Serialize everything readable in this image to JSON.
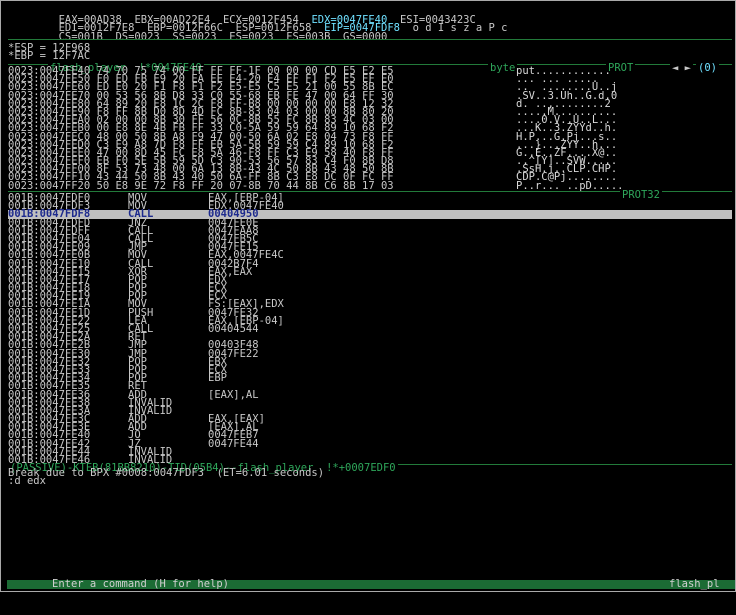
{
  "regs": [
    "EAX=00AD38  EBX=00AD22E4  ECX=0012F454  EDX=0047FE40  ESI=0043423C",
    "EDI=0012F7E8  EBP=0012F66C  ESP=0012F658  EIP=0047FDF8  o d I s z a P c",
    "CS=001B  DS=0023  SS=0023  ES=0023  FS=003B  GS=0000"
  ],
  "stack": [
    "*ESP = 12F968",
    "*EBP = 12F7AC"
  ],
  "data_label": "flash_player  !*0047FE40",
  "data_byte_label": "byte",
  "data_prot_label": "PROT",
  "data_index": "(0)",
  "data_rows": [
    {
      "addr": "0023:0047FE40",
      "bytes": "74 70 75 74 00 FF FF FF-1F 00 00 00 CD E5 E2 E5",
      "ascii": "put............"
    },
    {
      "addr": "0023:0047FE50",
      "bytes": "F0 ED FB E9 20 EA EE E4-20 E4 EF F1 F2 E5 EF E0",
      "ascii": "... ... ....."
    },
    {
      "addr": "0023:0047FE60",
      "bytes": "ED E0 20 F1 F8 F1 F2 E5-E5 C5 E5 21 00 55 8B EC",
      "ascii": "..  ........U..j"
    },
    {
      "addr": "0023:0047FE70",
      "bytes": "00 53 56 8B D8 33 C0 55-68 EB FE 47 00 64 FF 30",
      "ascii": ".SV..3.Uh..G.d.0"
    },
    {
      "addr": "0023:0047FE80",
      "bytes": "64 89 20 E8 1C 2C F8 FF-B8 00 00 00 00 E8 12 32",
      "ascii": "d. ..,........2"
    },
    {
      "addr": "0023:0047FE90",
      "bytes": "F8 FF 8B D0 8D 4D FC 8B-83 04 03 00 00 8B 80 20",
      "ascii": ".....M.........."
    },
    {
      "addr": "0023:0047FEA0",
      "bytes": "02 00 00 8B 30 FF 56 0C-8B 55 FC 8B 83 4C 03 00",
      "ascii": "....0.V..U..L..."
    },
    {
      "addr": "0023:0047FEB0",
      "bytes": "00 E8 8E 4B FB FF 33 C0-5A 59 59 64 89 10 68 F2",
      "ascii": "...K..3.ZYYd..h."
    },
    {
      "addr": "0023:0047FEC0",
      "bytes": "48 00 50 8B A8 F9 47 00-50 6A 02 E8 04 73 F8 FF",
      "ascii": "H.P...G.Pj...s.."
    },
    {
      "addr": "0023:0047FED0",
      "bytes": "C3 E9 A8 7D F8 FF EB 5A-5B 59 59 C4 89 10 68 F2",
      "ascii": "...}...ZYY..h..."
    },
    {
      "addr": "0023:0047FEE0",
      "bytes": "47 00 8D 45 FC E8 5A 46-F8 FF C3 E9 58 40 F8 FF",
      "ascii": "G..E..ZF....X@.."
    },
    {
      "addr": "0023:0047FEF0",
      "bytes": "EB F0 5E 5B 59 5D C3 90-53 56 57 83 C4 F0 8B D8",
      "ascii": "..^[Y]..SVW....."
    },
    {
      "addr": "0023:0047FF00",
      "bytes": "8F 53 73 48 00 6A 13 8B-43 4C 50 8B 43 48 50 8B",
      "ascii": ".SsH.j..CLP.CHP."
    },
    {
      "addr": "0023:0047FF10",
      "bytes": "43 44 50 8B 43 40 50 6A-FF 8B C3 E8 DC 0F FC FF",
      "ascii": "CDP.C@Pj........"
    },
    {
      "addr": "0023:0047FF20",
      "bytes": "50 E8 9E 72 F8 FF 20 07-8B 70 44 8B C6 8B 17 03",
      "ascii": "P..r... ..pD....."
    }
  ],
  "code_prot_label": "PROT32",
  "code_rows": [
    {
      "addr": "001B:0047FDF0",
      "mnem": "MOV",
      "ops": "EAX,[EBP-04]"
    },
    {
      "addr": "001B:0047FDF3",
      "mnem": "MOV",
      "ops": "EDX,0047FE40"
    },
    {
      "addr": "001B:0047FDF8",
      "mnem": "CALL",
      "ops": "00404950",
      "selected": true
    },
    {
      "addr": "001B:0047FDFD",
      "mnem": "JNZ",
      "ops": "0047FE0E"
    },
    {
      "addr": "001B:0047FDFF",
      "mnem": "CALL",
      "ops": "0047FAA8"
    },
    {
      "addr": "001B:0047FE04",
      "mnem": "CALL",
      "ops": "0047FB5C"
    },
    {
      "addr": "001B:0047FE09",
      "mnem": "JMP",
      "ops": "0047FE15"
    },
    {
      "addr": "001B:0047FE0B",
      "mnem": "MOV",
      "ops": "EAX,0047FE4C"
    },
    {
      "addr": "001B:0047FE10",
      "mnem": "CALL",
      "ops": "0042B7F4"
    },
    {
      "addr": "001B:0047FE15",
      "mnem": "XOR",
      "ops": "EAX,EAX"
    },
    {
      "addr": "001B:0047FE17",
      "mnem": "POP",
      "ops": "EDX"
    },
    {
      "addr": "001B:0047FE18",
      "mnem": "POP",
      "ops": "ECX"
    },
    {
      "addr": "001B:0047FE19",
      "mnem": "POP",
      "ops": "ECX"
    },
    {
      "addr": "001B:0047FE1A",
      "mnem": "MOV",
      "ops": "FS:[EAX],EDX"
    },
    {
      "addr": "001B:0047FE1D",
      "mnem": "PUSH",
      "ops": "0047FE32"
    },
    {
      "addr": "001B:0047FE22",
      "mnem": "LEA",
      "ops": "EAX,[EBP-04]"
    },
    {
      "addr": "001B:0047FE25",
      "mnem": "CALL",
      "ops": "00404544"
    },
    {
      "addr": "001B:0047FE2A",
      "mnem": "RET",
      "ops": ""
    },
    {
      "addr": "001B:0047FE2B",
      "mnem": "JMP",
      "ops": "00403F48"
    },
    {
      "addr": "001B:0047FE30",
      "mnem": "JMP",
      "ops": "0047FE22"
    },
    {
      "addr": "001B:0047FE32",
      "mnem": "POP",
      "ops": "EBX"
    },
    {
      "addr": "001B:0047FE33",
      "mnem": "POP",
      "ops": "ECX"
    },
    {
      "addr": "001B:0047FE34",
      "mnem": "POP",
      "ops": "EBP"
    },
    {
      "addr": "001B:0047FE35",
      "mnem": "RET",
      "ops": ""
    },
    {
      "addr": "001B:0047FE36",
      "mnem": "ADD",
      "ops": "[EAX],AL"
    },
    {
      "addr": "001B:0047FE38",
      "mnem": "INVALID",
      "ops": ""
    },
    {
      "addr": "001B:0047FE3A",
      "mnem": "INVALID",
      "ops": ""
    },
    {
      "addr": "001B:0047FE3C",
      "mnem": "ADD",
      "ops": "EAX,[EAX]"
    },
    {
      "addr": "001B:0047FE3E",
      "mnem": "ADD",
      "ops": "[EAX],AL"
    },
    {
      "addr": "001B:0047FE40",
      "mnem": "JO",
      "ops": "0047FEB7"
    },
    {
      "addr": "001B:0047FE42",
      "mnem": "JZ",
      "ops": "0047FE44"
    },
    {
      "addr": "001B:0047FE44",
      "mnem": "INVALID",
      "ops": ""
    },
    {
      "addr": "001B:0047FE46",
      "mnem": "INVALID",
      "ops": ""
    }
  ],
  "code_footer": "(PASSIVE)-KTEB(81BB8210)-TID(05B4)--flash_player  !*+0007EDF0",
  "log_lines": [
    "Break due to BPX #0008:0047FDF3  (ET=6.01 seconds)",
    ":d edx"
  ],
  "statusbar": {
    "hint": "Enter a command (H for help)",
    "owner": "flash_pl"
  }
}
